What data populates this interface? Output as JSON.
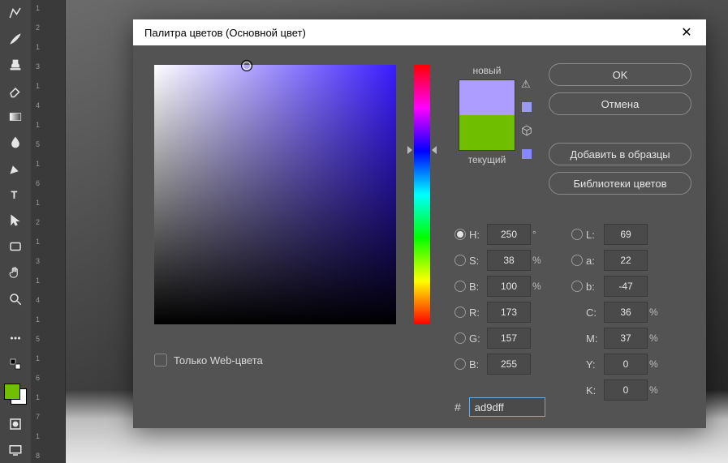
{
  "toolbar": {
    "tools": [
      {
        "name": "lasso-poly-icon"
      },
      {
        "name": "brush-icon"
      },
      {
        "name": "stamp-icon"
      },
      {
        "name": "eraser-icon"
      },
      {
        "name": "gradient-icon"
      },
      {
        "name": "blur-icon"
      },
      {
        "name": "pen-icon"
      },
      {
        "name": "type-icon"
      },
      {
        "name": "path-select-icon"
      },
      {
        "name": "rectangle-icon"
      },
      {
        "name": "hand-icon"
      },
      {
        "name": "zoom-icon"
      }
    ],
    "foreground_color": "#6fbf00",
    "background_color": "#ffffff"
  },
  "ruler": {
    "labels": [
      "1",
      "2",
      "1",
      "3",
      "1",
      "4",
      "1",
      "5",
      "1",
      "6",
      "1",
      "2",
      "1",
      "3",
      "1",
      "4",
      "1",
      "5",
      "1",
      "6",
      "1",
      "7",
      "1",
      "8"
    ]
  },
  "dialog": {
    "title": "Палитра цветов (Основной цвет)",
    "buttons": {
      "ok": "OK",
      "cancel": "Отмена",
      "add_swatch": "Добавить в образцы",
      "libraries": "Библиотеки цветов"
    },
    "preview": {
      "new_label": "новый",
      "current_label": "текущий",
      "new_color": "#ad9dff",
      "current_color": "#6fbf00"
    },
    "sv_marker": {
      "x_pct": 38,
      "y_pct": 0
    },
    "web_only": {
      "label": "Только Web-цвета",
      "checked": false
    },
    "model": {
      "H": {
        "label": "H:",
        "value": "250",
        "unit": "°"
      },
      "S": {
        "label": "S:",
        "value": "38",
        "unit": "%"
      },
      "Bv": {
        "label": "B:",
        "value": "100",
        "unit": "%"
      },
      "R": {
        "label": "R:",
        "value": "173",
        "unit": ""
      },
      "G": {
        "label": "G:",
        "value": "157",
        "unit": ""
      },
      "Bc": {
        "label": "B:",
        "value": "255",
        "unit": ""
      },
      "L": {
        "label": "L:",
        "value": "69",
        "unit": ""
      },
      "a": {
        "label": "a:",
        "value": "22",
        "unit": ""
      },
      "b": {
        "label": "b:",
        "value": "-47",
        "unit": ""
      },
      "C": {
        "label": "C:",
        "value": "36",
        "unit": "%"
      },
      "M": {
        "label": "M:",
        "value": "37",
        "unit": "%"
      },
      "Y": {
        "label": "Y:",
        "value": "0",
        "unit": "%"
      },
      "K": {
        "label": "K:",
        "value": "0",
        "unit": "%"
      }
    },
    "hex": {
      "prefix": "#",
      "value": "ad9dff"
    },
    "selected_radio": "H"
  }
}
